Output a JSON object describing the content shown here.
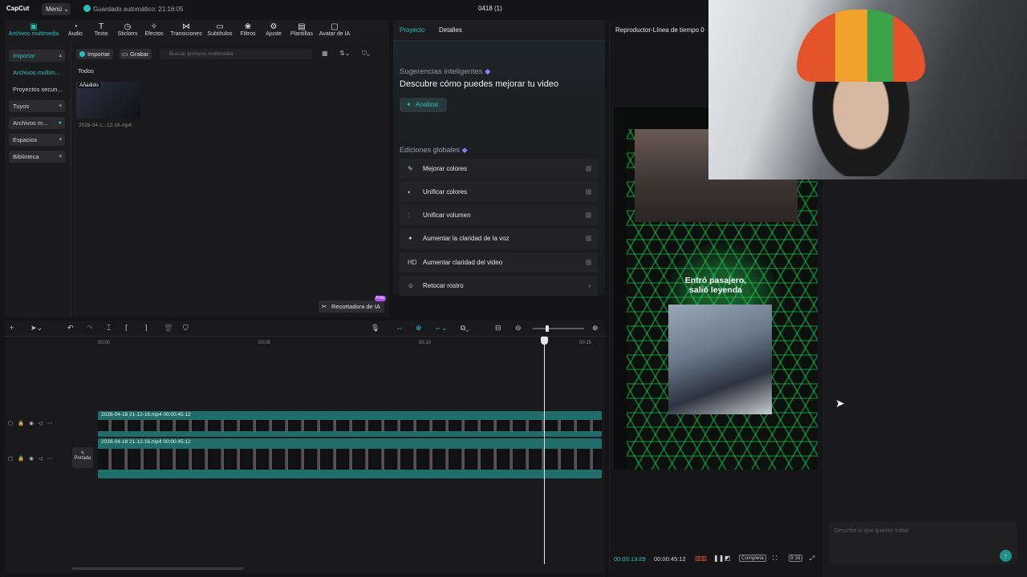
{
  "app": {
    "logo": "CapCut",
    "menu_label": "Menú ⌄",
    "autosave": "Guardado automático: 21:16:05",
    "project_title": "0418 (1)"
  },
  "toolbar": [
    {
      "icon": "media-icon",
      "glyph": "▣",
      "label": "Archivos multimedia"
    },
    {
      "icon": "audio-icon",
      "glyph": "◔",
      "label": "Audio"
    },
    {
      "icon": "text-icon",
      "glyph": "T",
      "label": "Texto"
    },
    {
      "icon": "stickers-icon",
      "glyph": "◷",
      "label": "Stickers"
    },
    {
      "icon": "effects-icon",
      "glyph": "✧",
      "label": "Efectos"
    },
    {
      "icon": "transitions-icon",
      "glyph": "⋈",
      "label": "Transiciones"
    },
    {
      "icon": "subtitles-icon",
      "glyph": "▭",
      "label": "Subtítulos"
    },
    {
      "icon": "filters-icon",
      "glyph": "❀",
      "label": "Filtros"
    },
    {
      "icon": "adjust-icon",
      "glyph": "⚙",
      "label": "Ajuste"
    },
    {
      "icon": "templates-icon",
      "glyph": "▤",
      "label": "Plantillas"
    },
    {
      "icon": "ai-avatar-icon",
      "glyph": "▢",
      "label": "Avatar de IA"
    }
  ],
  "sidebar": [
    {
      "label": "Importar",
      "chev": "▴"
    },
    {
      "label": "Archivos multim...",
      "chev": ""
    },
    {
      "label": "Proyectos secun...",
      "chev": ""
    },
    {
      "label": "Tuyos",
      "chev": "▾"
    },
    {
      "label": "Archivos m...",
      "chev": "●"
    },
    {
      "label": "Espacios",
      "chev": "▾"
    },
    {
      "label": "Biblioteca",
      "chev": "▾"
    }
  ],
  "media": {
    "import_btn": "Importar",
    "record_btn": "Grabar",
    "search_placeholder": "Buscar archivos multimedia",
    "filter_all": "Todos",
    "item_tag": "Añadido",
    "item_name": "2026-04-1...12-16.mp4",
    "recortadora": "Recortadora de IA",
    "free_badge": "Free"
  },
  "mid": {
    "tab_project": "Proyecto",
    "tab_details": "Detalles",
    "sug_title": "Sugerencias inteligentes",
    "sug_sub": "Descubre cómo puedes mejorar tu video",
    "analyze": "Analizar",
    "global_title": "Ediciones globales",
    "rows": [
      {
        "icon": "enhance-color-icon",
        "glyph": "✎",
        "label": "Mejorar colores"
      },
      {
        "icon": "unify-color-icon",
        "glyph": "◐",
        "label": "Unificar colores"
      },
      {
        "icon": "unify-volume-icon",
        "glyph": "⫶",
        "label": "Unificar volumen"
      },
      {
        "icon": "voice-clarity-icon",
        "glyph": "✦",
        "label": "Aumentar la claridad de la voz"
      },
      {
        "icon": "hd-icon",
        "glyph": "HD",
        "label": "Aumentar claridad del video"
      },
      {
        "icon": "retouch-face-icon",
        "glyph": "☺",
        "label": "Retocar rostro"
      }
    ]
  },
  "player": {
    "title": "Reproductor-Línea de tiempo 0",
    "caption_line1": "Entró pasajero,",
    "caption_line2": "salió leyenda",
    "current_time": "00:00:13:29",
    "total_time": "00:00:45:12",
    "complete_btn": "Completa",
    "ratio_btn": "9:16"
  },
  "chat": {
    "placeholder": "Describe lo que quieres editar"
  },
  "timeline": {
    "ruler": [
      "00:00",
      "00:05",
      "00:10",
      "00:15"
    ],
    "track1_label": "2026-04-18 21-12-16.mp4  00:00:45:12",
    "track2_label": "2026-04-18 21-12-16.mp4  00:00:45:12",
    "portada": "Portada"
  },
  "colors": {
    "accent": "#22c3bf",
    "bg": "#141416",
    "panel": "#1c1c1f",
    "track": "#1f6e6a"
  }
}
